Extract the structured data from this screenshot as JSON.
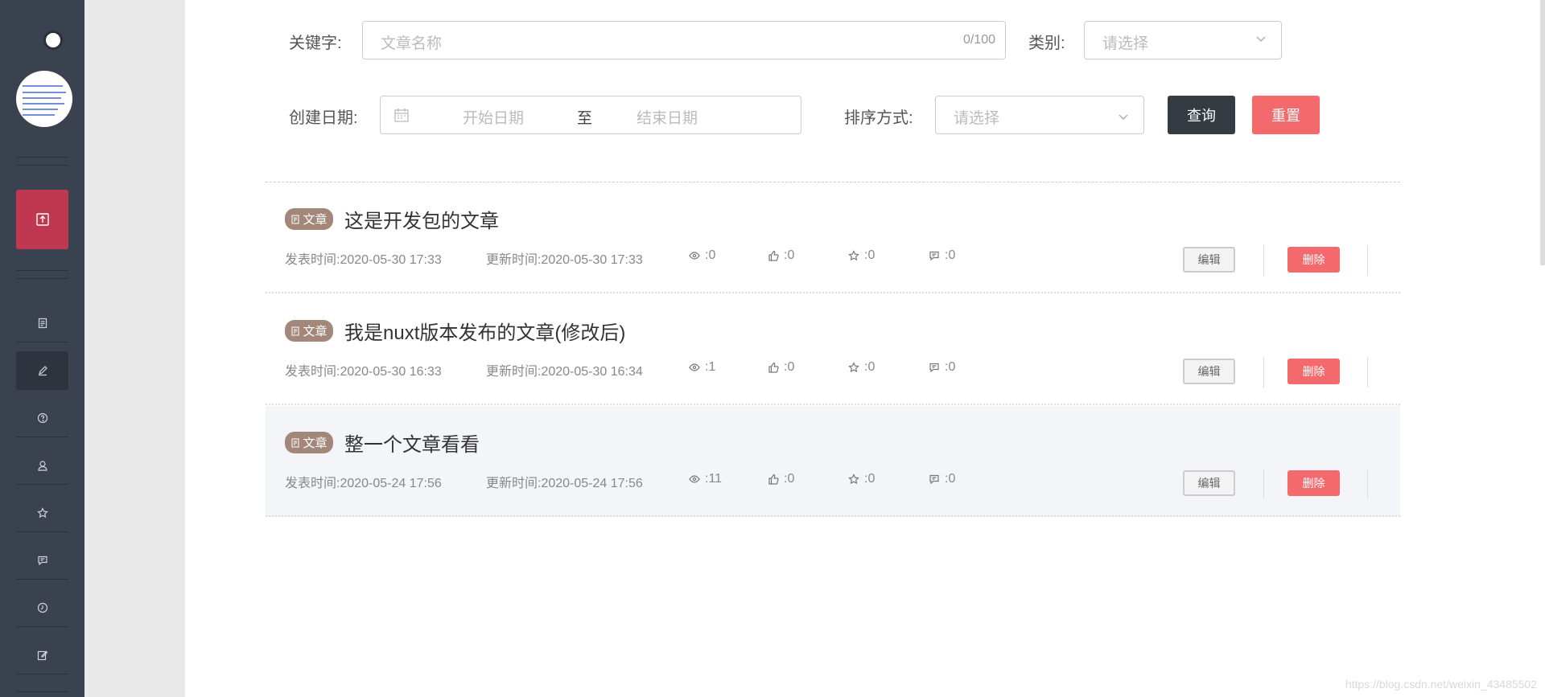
{
  "sidebar": {
    "items": [
      {
        "icon": "document-icon"
      },
      {
        "icon": "edit-icon",
        "active": true
      },
      {
        "icon": "help-icon"
      },
      {
        "icon": "user-icon"
      },
      {
        "icon": "star-icon"
      },
      {
        "icon": "comment-icon"
      },
      {
        "icon": "clock-icon"
      },
      {
        "icon": "write-icon"
      }
    ]
  },
  "filters": {
    "keyword_label": "关键字:",
    "keyword_placeholder": "文章名称",
    "keyword_counter": "0/100",
    "category_label": "类别:",
    "category_placeholder": "请选择",
    "date_label": "创建日期:",
    "date_start_placeholder": "开始日期",
    "date_separator": "至",
    "date_end_placeholder": "结束日期",
    "sort_label": "排序方式:",
    "sort_placeholder": "请选择",
    "query_button": "查询",
    "reset_button": "重置"
  },
  "articles": [
    {
      "badge": "文章",
      "title": "这是开发包的文章",
      "published": "发表时间:2020-05-30 17:33",
      "updated": "更新时间:2020-05-30 17:33",
      "views": ":0",
      "likes": ":0",
      "stars": ":0",
      "comments": ":0",
      "edit": "编辑",
      "delete": "删除"
    },
    {
      "badge": "文章",
      "title": "我是nuxt版本发布的文章(修改后)",
      "published": "发表时间:2020-05-30 16:33",
      "updated": "更新时间:2020-05-30 16:34",
      "views": ":1",
      "likes": ":0",
      "stars": ":0",
      "comments": ":0",
      "edit": "编辑",
      "delete": "删除"
    },
    {
      "badge": "文章",
      "title": "整一个文章看看",
      "published": "发表时间:2020-05-24 17:56",
      "updated": "更新时间:2020-05-24 17:56",
      "views": ":11",
      "likes": ":0",
      "stars": ":0",
      "comments": ":0",
      "edit": "编辑",
      "delete": "删除"
    }
  ],
  "watermark": "https://blog.csdn.net/weixin_43485502",
  "colors": {
    "sidebar": "#3a4250",
    "publish": "#c0384f",
    "danger": "#f3696c",
    "dark_button": "#353b42",
    "badge": "#a3887a"
  }
}
